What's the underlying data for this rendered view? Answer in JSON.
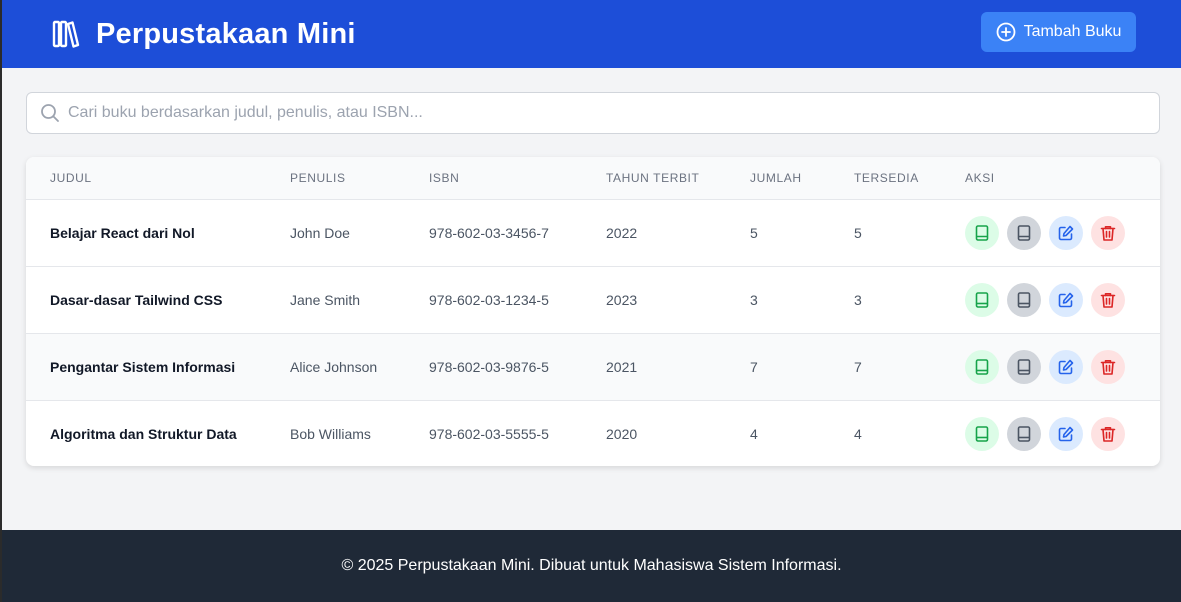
{
  "header": {
    "title": "Perpustakaan Mini",
    "add_button_label": "Tambah Buku",
    "brand_icon": "library-books-icon",
    "add_icon": "plus-circle-icon",
    "color": "#1d4ed8"
  },
  "search": {
    "placeholder": "Cari buku berdasarkan judul, penulis, atau ISBN...",
    "value": "",
    "icon": "search-icon"
  },
  "table": {
    "columns": [
      "JUDUL",
      "PENULIS",
      "ISBN",
      "TAHUN TERBIT",
      "JUMLAH",
      "TERSEDIA",
      "AKSI"
    ],
    "rows": [
      {
        "title": "Belajar React dari Nol",
        "author": "John Doe",
        "isbn": "978-602-03-3456-7",
        "year": "2022",
        "qty": "5",
        "available": "5"
      },
      {
        "title": "Dasar-dasar Tailwind CSS",
        "author": "Jane Smith",
        "isbn": "978-602-03-1234-5",
        "year": "2023",
        "qty": "3",
        "available": "3"
      },
      {
        "title": "Pengantar Sistem Informasi",
        "author": "Alice Johnson",
        "isbn": "978-602-03-9876-5",
        "year": "2021",
        "qty": "7",
        "available": "7"
      },
      {
        "title": "Algoritma dan Struktur Data",
        "author": "Bob Williams",
        "isbn": "978-602-03-5555-5",
        "year": "2020",
        "qty": "4",
        "available": "4"
      }
    ],
    "action_icons": [
      "book-borrow-icon",
      "book-return-icon",
      "edit-icon",
      "trash-icon"
    ],
    "action_colors": {
      "green": "#16a34a",
      "gray": "#4b5563",
      "blue": "#2563eb",
      "red": "#dc2626"
    }
  },
  "footer": {
    "text": "© 2025 Perpustakaan Mini. Dibuat untuk Mahasiswa Sistem Informasi."
  }
}
